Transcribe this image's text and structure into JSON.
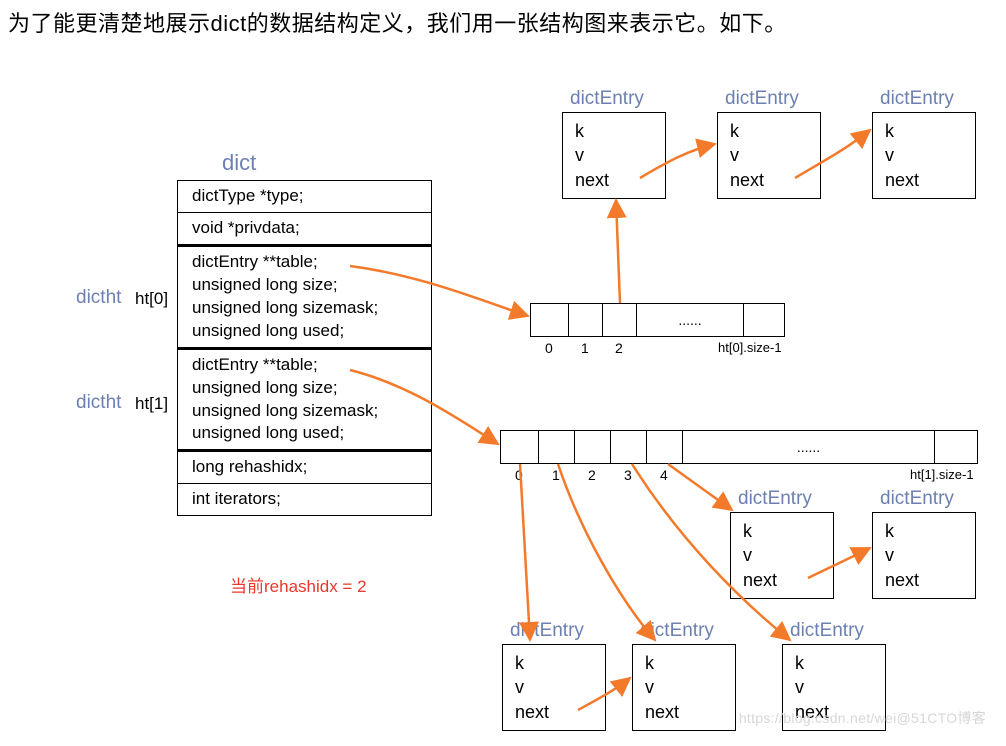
{
  "intro": "为了能更清楚地展示dict的数据结构定义，我们用一张结构图来表示它。如下。",
  "dict": {
    "title": "dict",
    "rows": {
      "type": "dictType *type;",
      "priv": "void *privdata;",
      "ht0_l1": "dictEntry **table;",
      "ht0_l2": "unsigned long size;",
      "ht0_l3": "unsigned long sizemask;",
      "ht0_l4": "unsigned long used;",
      "ht1_l1": "dictEntry **table;",
      "ht1_l2": "unsigned long size;",
      "ht1_l3": "unsigned long sizemask;",
      "ht1_l4": "unsigned long used;",
      "rehash": "long rehashidx;",
      "iters": "int iterators;"
    }
  },
  "sideLabels": {
    "dictht": "dictht",
    "ht0": "ht[0]",
    "ht1": "ht[1]"
  },
  "arr0": {
    "idx0": "0",
    "idx1": "1",
    "idx2": "2",
    "dots": "......",
    "sizeLabel": "ht[0].size-1"
  },
  "arr1": {
    "idx0": "0",
    "idx1": "1",
    "idx2": "2",
    "idx3": "3",
    "idx4": "4",
    "dots": "......",
    "sizeLabel": "ht[1].size-1"
  },
  "entry": {
    "title": "dictEntry",
    "k": "k",
    "v": "v",
    "next": "next"
  },
  "note": "当前rehashidx = 2",
  "watermark": "https://blog.csdn.net/wei@51CTO博客"
}
